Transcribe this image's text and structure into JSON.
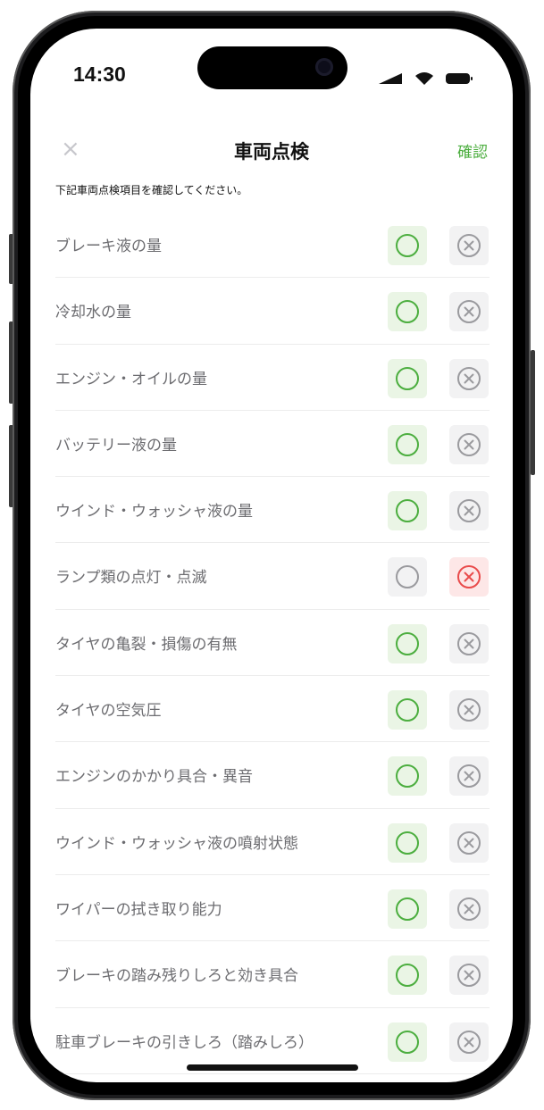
{
  "status_bar": {
    "time": "14:30"
  },
  "nav": {
    "close_label": "×",
    "title": "車両点検",
    "confirm_label": "確認"
  },
  "instruction": "下記車両点検項目を確認してください。",
  "colors": {
    "accent_green": "#4cae3f",
    "ng_red": "#e94b4b",
    "gray": "#9a9a9e"
  },
  "items": [
    {
      "label": "ブレーキ液の量",
      "status": "ok"
    },
    {
      "label": "冷却水の量",
      "status": "ok"
    },
    {
      "label": "エンジン・オイルの量",
      "status": "ok"
    },
    {
      "label": "バッテリー液の量",
      "status": "ok"
    },
    {
      "label": "ウインド・ウォッシャ液の量",
      "status": "ok"
    },
    {
      "label": "ランプ類の点灯・点滅",
      "status": "ng"
    },
    {
      "label": "タイヤの亀裂・損傷の有無",
      "status": "ok"
    },
    {
      "label": "タイヤの空気圧",
      "status": "ok"
    },
    {
      "label": "エンジンのかかり具合・異音",
      "status": "ok"
    },
    {
      "label": "ウインド・ウォッシャ液の噴射状態",
      "status": "ok"
    },
    {
      "label": "ワイパーの拭き取り能力",
      "status": "ok"
    },
    {
      "label": "ブレーキの踏み残りしろと効き具合",
      "status": "ok"
    },
    {
      "label": "駐車ブレーキの引きしろ（踏みしろ）",
      "status": "ok"
    }
  ]
}
